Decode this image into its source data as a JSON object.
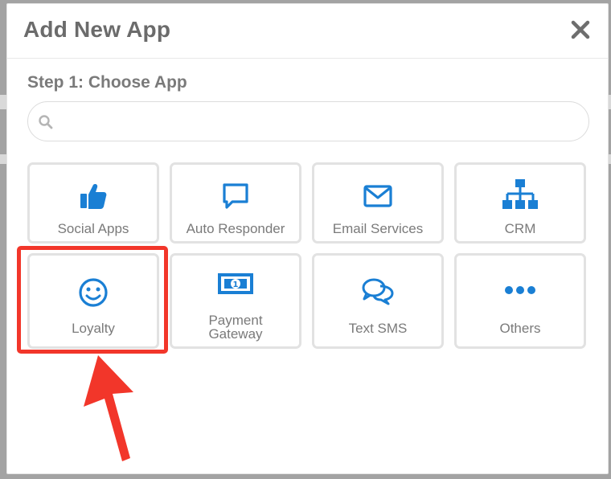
{
  "modal": {
    "title": "Add New App",
    "close_icon": "close-icon"
  },
  "step": {
    "title": "Step 1: Choose App"
  },
  "search": {
    "placeholder": "",
    "value": "",
    "icon": "search-icon"
  },
  "apps": [
    {
      "label": "Social Apps",
      "icon": "thumbs-up-icon"
    },
    {
      "label": "Auto Responder",
      "icon": "speech-bubble-icon"
    },
    {
      "label": "Email Services",
      "icon": "envelope-icon"
    },
    {
      "label": "CRM",
      "icon": "sitemap-icon"
    },
    {
      "label": "Loyalty",
      "icon": "smiley-icon"
    },
    {
      "label": "Payment Gateway",
      "icon": "money-bill-icon"
    },
    {
      "label": "Text SMS",
      "icon": "chat-bubbles-icon"
    },
    {
      "label": "Others",
      "icon": "ellipsis-icon"
    }
  ],
  "colors": {
    "accent": "#1a7fd4",
    "highlight": "#f2362a",
    "text": "#7a7a7a"
  }
}
